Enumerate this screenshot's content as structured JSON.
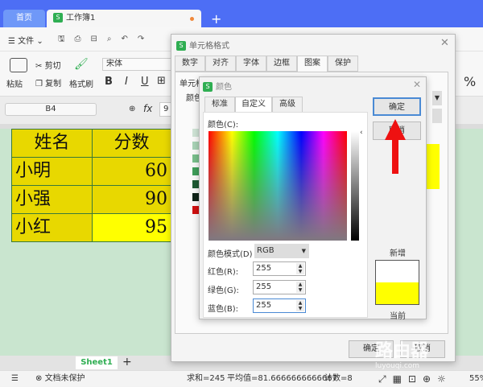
{
  "tabs": {
    "home": "首页",
    "workbook": "工作簿1",
    "new_tab": "+"
  },
  "menu": {
    "file": "文件"
  },
  "ribbon": {
    "paste": "粘贴",
    "cut": "剪切",
    "copy": "复制",
    "format_painter": "格式刷",
    "font": "宋体",
    "bold": "B",
    "italic": "I",
    "underline": "U"
  },
  "formula": {
    "cell_ref": "B4",
    "fx": "fx",
    "value": "9"
  },
  "table": {
    "rows": [
      [
        "姓名",
        "分数"
      ],
      [
        "小明",
        "60"
      ],
      [
        "小强",
        "90"
      ],
      [
        "小红",
        "95"
      ]
    ]
  },
  "sheet_tab": "Sheet1",
  "status": {
    "protect": "文档未保护",
    "sum": "求和=245",
    "avg": "平均值=81.6666666666667",
    "count": "计数=8",
    "zoom": "55%"
  },
  "format_dialog": {
    "title": "单元格格式",
    "tabs": [
      "数字",
      "对齐",
      "字体",
      "边框",
      "图案",
      "保护"
    ],
    "active_tab": "图案",
    "shading_label": "单元格底纹",
    "color_label": "颜色",
    "ok": "确定",
    "cancel": "取消"
  },
  "color_dialog": {
    "title": "颜色",
    "tabs": [
      "标准",
      "自定义",
      "高级"
    ],
    "active_tab": "自定义",
    "color_label": "颜色(C):",
    "mode_label": "颜色模式(D)",
    "mode_value": "RGB",
    "red_label": "红色(R):",
    "red": "255",
    "green_label": "绿色(G):",
    "green": "255",
    "blue_label": "蓝色(B):",
    "blue": "255",
    "new_label": "新增",
    "current_label": "当前",
    "ok": "确定",
    "cancel": "取消",
    "new_color": "#ffffff",
    "current_color": "#ffff00"
  },
  "watermark": {
    "text": "路由器",
    "url": "luyouqi.com"
  }
}
